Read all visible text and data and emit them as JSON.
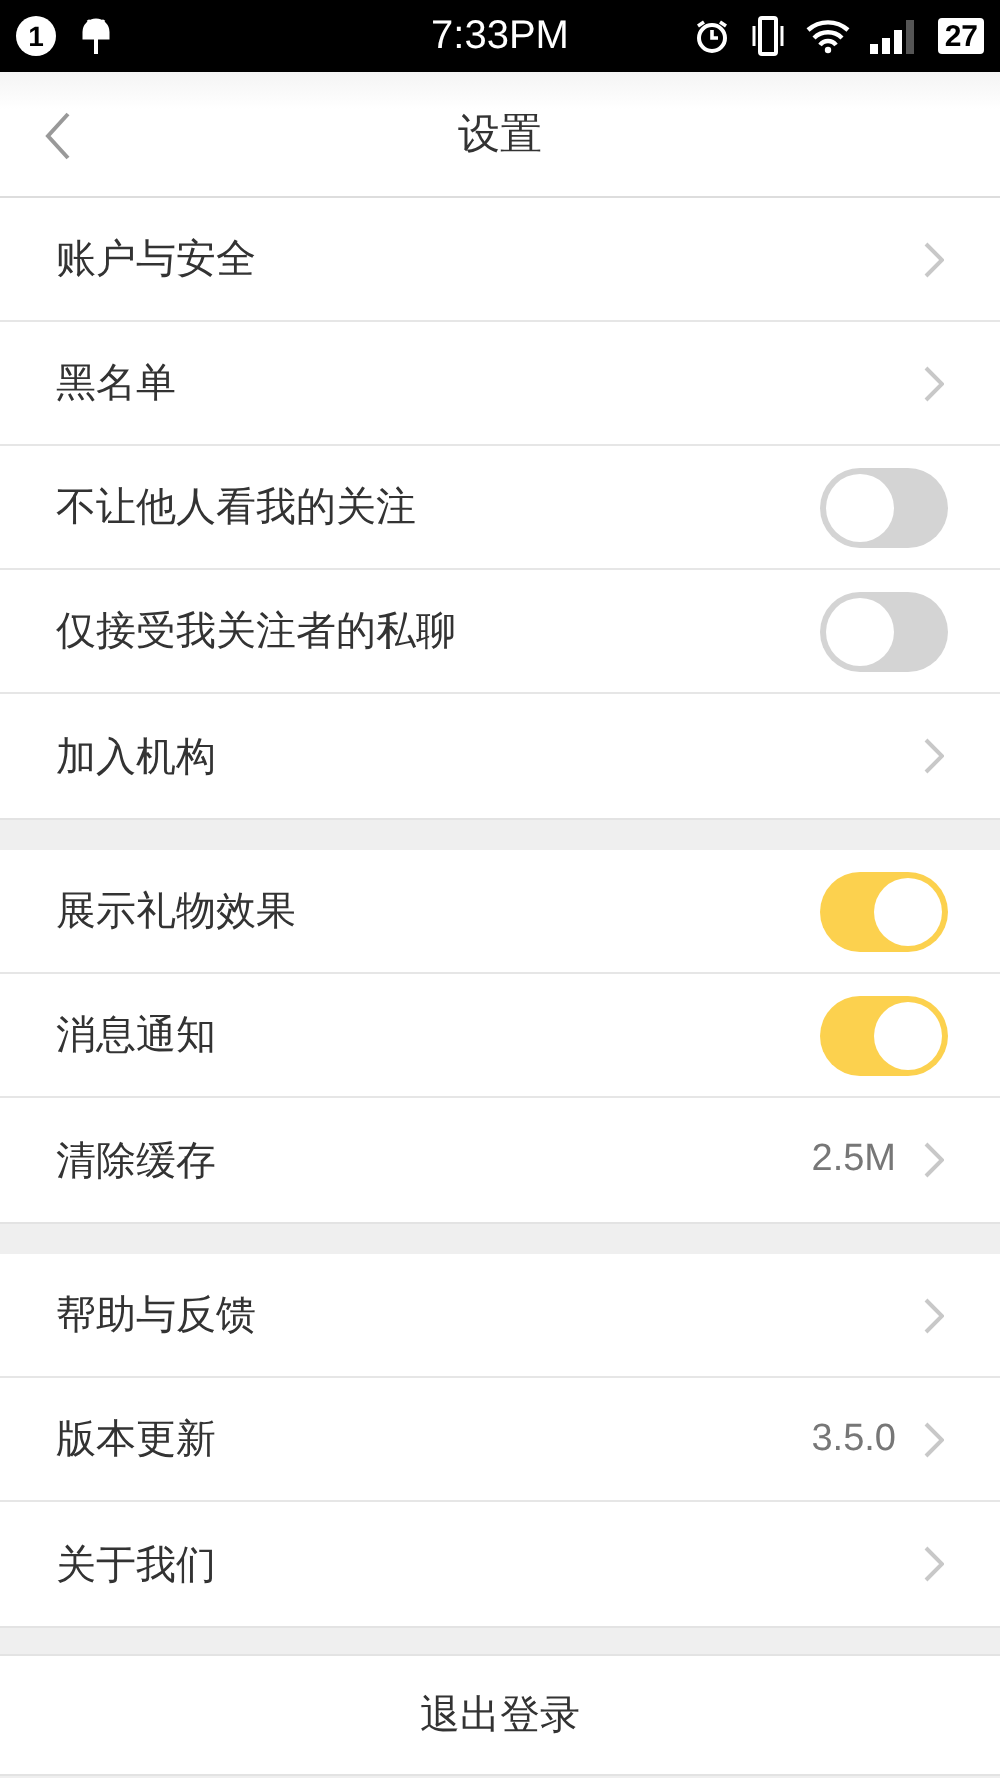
{
  "status_bar": {
    "notification_count": "1",
    "time": "7:33PM",
    "battery": "27"
  },
  "header": {
    "title": "设置"
  },
  "groups": [
    {
      "items": [
        {
          "kind": "link",
          "label": "账户与安全"
        },
        {
          "kind": "link",
          "label": "黑名单"
        },
        {
          "kind": "toggle",
          "label": "不让他人看我的关注",
          "on": false
        },
        {
          "kind": "toggle",
          "label": "仅接受我关注者的私聊",
          "on": false
        },
        {
          "kind": "link",
          "label": "加入机构"
        }
      ]
    },
    {
      "items": [
        {
          "kind": "toggle",
          "label": "展示礼物效果",
          "on": true
        },
        {
          "kind": "toggle",
          "label": "消息通知",
          "on": true
        },
        {
          "kind": "link",
          "label": "清除缓存",
          "value": "2.5M"
        }
      ]
    },
    {
      "items": [
        {
          "kind": "link",
          "label": "帮助与反馈"
        },
        {
          "kind": "link",
          "label": "版本更新",
          "value": "3.5.0"
        },
        {
          "kind": "link",
          "label": "关于我们"
        }
      ]
    }
  ],
  "logout_button": "退出登录"
}
